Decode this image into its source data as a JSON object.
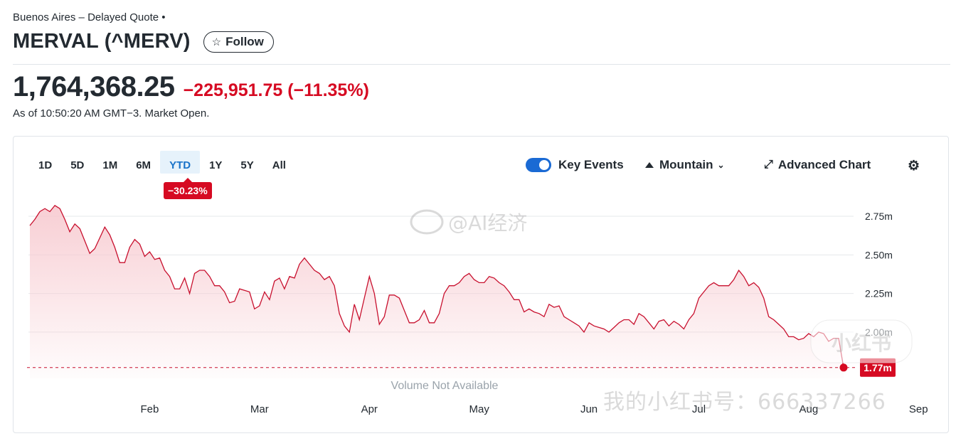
{
  "header": {
    "exchange_note": "Buenos Aires – Delayed Quote •",
    "title": "MERVAL (^MERV)",
    "follow_label": "Follow",
    "price": "1,764,368.25",
    "change": "−225,951.75 (−11.35%)",
    "as_of": "As of 10:50:20 AM GMT−3. Market Open."
  },
  "toolbar": {
    "ranges": [
      "1D",
      "5D",
      "1M",
      "6M",
      "YTD",
      "1Y",
      "5Y",
      "All"
    ],
    "active_range": "YTD",
    "ytd_change_badge": "−30.23%",
    "key_events_label": "Key Events",
    "key_events_on": true,
    "chart_type_label": "Mountain",
    "advanced_chart_label": "Advanced Chart"
  },
  "watermarks": {
    "weibo": "@AI经济",
    "xiaohongshu_logo": "小红书",
    "xiaohongshu_id": "我的小红书号：666337266"
  },
  "colors": {
    "line": "#c8102e",
    "fill_top": "#f7c9cf",
    "down": "#d60a22",
    "accent": "#1a6ad4",
    "grid": "#e6e8eb"
  },
  "chart_data": {
    "type": "area",
    "title": "",
    "xlabel": "",
    "ylabel": "",
    "y_unit": "m",
    "ylim": [
      1.7,
      2.87
    ],
    "yticks": [
      1.77,
      2.0,
      2.25,
      2.5,
      2.75
    ],
    "ytick_labels": [
      "1.77m",
      "2.00m",
      "2.25m",
      "2.50m",
      "2.75m"
    ],
    "grid": true,
    "x_tick_labels": [
      "Feb",
      "Mar",
      "Apr",
      "May",
      "Jun",
      "Jul",
      "Aug",
      "Sep"
    ],
    "x_tick_index": [
      24,
      46,
      68,
      90,
      112,
      134,
      156,
      178
    ],
    "last_value": 1.77,
    "last_value_label": "1.77m",
    "volume_note": "Volume Not Available",
    "values": [
      2.69,
      2.73,
      2.78,
      2.8,
      2.78,
      2.82,
      2.8,
      2.73,
      2.65,
      2.7,
      2.67,
      2.59,
      2.51,
      2.54,
      2.61,
      2.68,
      2.63,
      2.55,
      2.45,
      2.45,
      2.55,
      2.6,
      2.57,
      2.49,
      2.52,
      2.47,
      2.48,
      2.4,
      2.36,
      2.28,
      2.28,
      2.35,
      2.25,
      2.38,
      2.4,
      2.4,
      2.36,
      2.3,
      2.3,
      2.26,
      2.19,
      2.2,
      2.28,
      2.27,
      2.26,
      2.15,
      2.17,
      2.26,
      2.21,
      2.33,
      2.35,
      2.28,
      2.36,
      2.35,
      2.44,
      2.48,
      2.44,
      2.4,
      2.38,
      2.34,
      2.36,
      2.3,
      2.12,
      2.04,
      2.0,
      2.18,
      2.08,
      2.22,
      2.36,
      2.25,
      2.05,
      2.1,
      2.24,
      2.24,
      2.22,
      2.14,
      2.06,
      2.06,
      2.08,
      2.14,
      2.06,
      2.06,
      2.12,
      2.25,
      2.3,
      2.3,
      2.32,
      2.36,
      2.38,
      2.34,
      2.32,
      2.32,
      2.36,
      2.35,
      2.32,
      2.3,
      2.26,
      2.21,
      2.21,
      2.13,
      2.15,
      2.13,
      2.12,
      2.1,
      2.18,
      2.16,
      2.17,
      2.1,
      2.08,
      2.06,
      2.04,
      2.0,
      2.06,
      2.04,
      2.03,
      2.02,
      2.0,
      2.03,
      2.06,
      2.08,
      2.08,
      2.05,
      2.12,
      2.1,
      2.06,
      2.02,
      2.07,
      2.08,
      2.04,
      2.07,
      2.05,
      2.02,
      2.08,
      2.12,
      2.22,
      2.26,
      2.3,
      2.32,
      2.3,
      2.3,
      2.3,
      2.34,
      2.4,
      2.36,
      2.3,
      2.32,
      2.29,
      2.22,
      2.1,
      2.08,
      2.05,
      2.02,
      1.97,
      1.97,
      1.95,
      1.96,
      1.99,
      1.97,
      2.0,
      1.99,
      1.94,
      1.96,
      1.96,
      1.77
    ]
  }
}
